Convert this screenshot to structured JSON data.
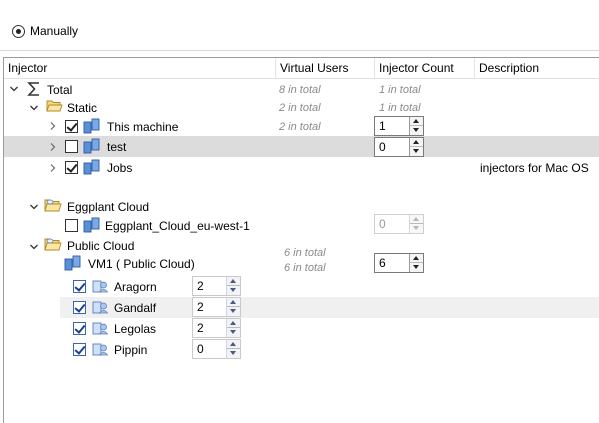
{
  "mode": {
    "label": "Manually"
  },
  "columns": {
    "injector": "Injector",
    "virtual_users": "Virtual Users",
    "injector_count": "Injector Count",
    "description": "Description"
  },
  "total": {
    "label": "Total",
    "vu": "8 in total",
    "count": "1 in total"
  },
  "static": {
    "label": "Static",
    "vu": "2 in total",
    "count": "1 in total"
  },
  "this_machine": {
    "label": "This machine",
    "vu": "2 in total",
    "count": "1"
  },
  "test": {
    "label": "test",
    "count": "0"
  },
  "jobs": {
    "label": "Jobs",
    "description": "injectors for Mac OS"
  },
  "eggplant_cloud": {
    "label": "Eggplant Cloud"
  },
  "eu_west": {
    "label": "Eggplant_Cloud_eu-west-1",
    "count": "0"
  },
  "public_cloud": {
    "label": "Public Cloud",
    "vu": "6 in total",
    "count": "6 in total"
  },
  "vm1": {
    "label": "VM1 ( Public Cloud)",
    "count": "6"
  },
  "vms": [
    {
      "label": "Aragorn",
      "value": "2"
    },
    {
      "label": "Gandalf",
      "value": "2"
    },
    {
      "label": "Legolas",
      "value": "2"
    },
    {
      "label": "Pippin",
      "value": "0"
    }
  ]
}
